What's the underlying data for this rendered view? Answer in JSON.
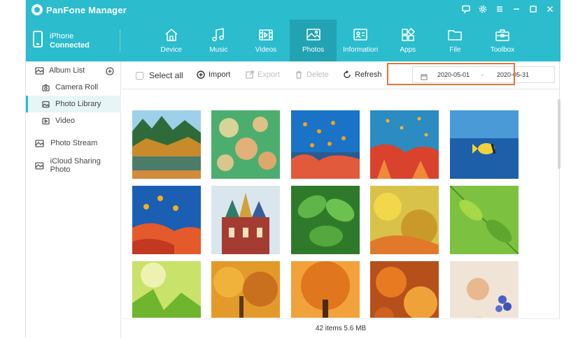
{
  "app": {
    "title": "PanFone Manager"
  },
  "device": {
    "name": "iPhone",
    "status": "Connected"
  },
  "nav": {
    "tabs": [
      {
        "label": "Device",
        "icon": "home-icon"
      },
      {
        "label": "Music",
        "icon": "music-note-icon"
      },
      {
        "label": "Videos",
        "icon": "film-icon"
      },
      {
        "label": "Photos",
        "icon": "image-icon",
        "active": true
      },
      {
        "label": "Information",
        "icon": "contact-card-icon"
      },
      {
        "label": "Apps",
        "icon": "apps-grid-icon"
      },
      {
        "label": "File",
        "icon": "folder-icon"
      },
      {
        "label": "Toolbox",
        "icon": "toolbox-icon"
      }
    ]
  },
  "sidebar": {
    "album_list_label": "Album List",
    "items": [
      {
        "label": "Camera Roll",
        "icon": "camera-icon"
      },
      {
        "label": "Photo Library",
        "icon": "image-icon",
        "active": true
      },
      {
        "label": "Video",
        "icon": "play-icon"
      }
    ],
    "photo_stream": "Photo Stream",
    "icloud_sharing": "iCloud Sharing Photo"
  },
  "toolbar": {
    "select_all": "Select all",
    "import": "Import",
    "export": "Export",
    "delete": "Delete",
    "refresh": "Refresh"
  },
  "date_filter": {
    "start": "2020-05-01",
    "separator": "-",
    "end": "2020-05-31",
    "highlight_color": "#e1753a"
  },
  "status": {
    "summary": "42 items 5.6 MB"
  },
  "colors": {
    "accent": "#2bbccd",
    "accent_active": "#22a3b3"
  }
}
